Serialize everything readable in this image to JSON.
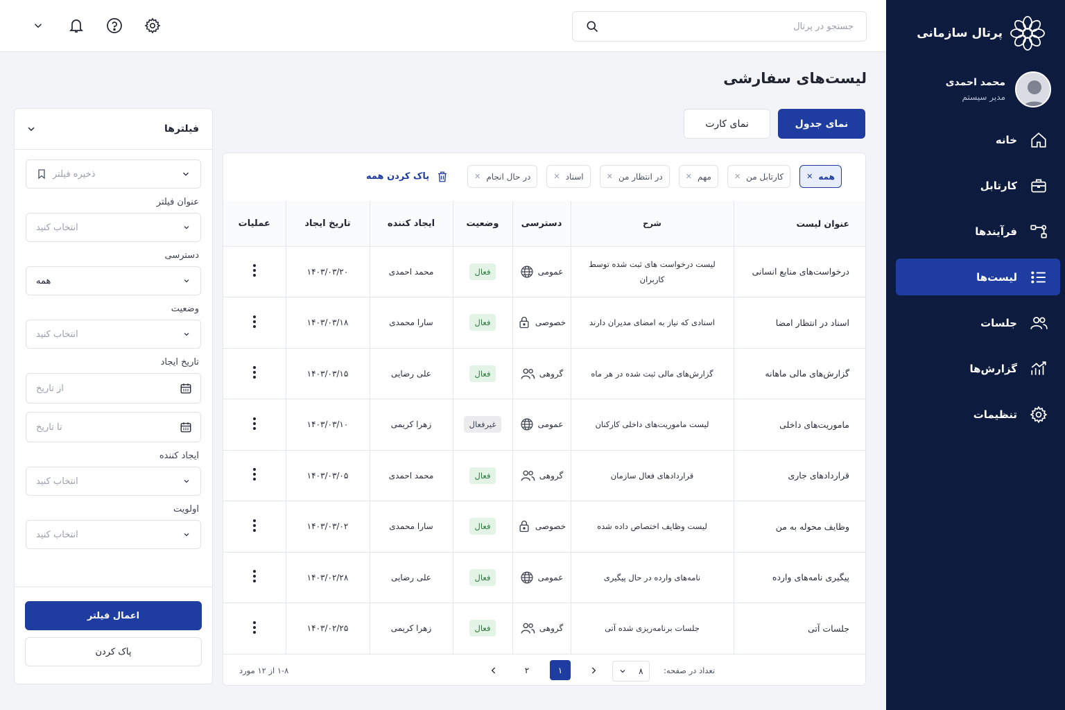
{
  "app": {
    "title": "پرتال سازمانی"
  },
  "user": {
    "name": "محمد احمدی",
    "role": "مدیر سیستم"
  },
  "sidebar": {
    "items": [
      {
        "label": "خانه",
        "icon": "home-icon",
        "active": false
      },
      {
        "label": "کارتابل",
        "icon": "briefcase-icon",
        "active": false
      },
      {
        "label": "فرآیندها",
        "icon": "workflow-icon",
        "active": false
      },
      {
        "label": "لیست‌ها",
        "icon": "list-icon",
        "active": true
      },
      {
        "label": "جلسات",
        "icon": "users-icon",
        "active": false
      },
      {
        "label": "گزارش‌ها",
        "icon": "chart-icon",
        "active": false
      },
      {
        "label": "تنظیمات",
        "icon": "gear-icon",
        "active": false
      }
    ]
  },
  "search": {
    "placeholder": "جستجو در پرتال",
    "value": ""
  },
  "page": {
    "title": "لیست‌های سفارشی"
  },
  "view_toggle": {
    "table": "نمای جدول",
    "card": "نمای کارت",
    "selected": "table"
  },
  "chips": [
    {
      "label": "همه",
      "active": true
    },
    {
      "label": "کارتابل من",
      "active": false
    },
    {
      "label": "مهم",
      "active": false
    },
    {
      "label": "در انتظار من",
      "active": false
    },
    {
      "label": "اسناد",
      "active": false
    },
    {
      "label": "در حال انجام",
      "active": false
    }
  ],
  "clear_all": "پاک کردن همه",
  "table": {
    "headers": {
      "title": "عنوان لیست",
      "desc": "شرح",
      "access": "دسترسی",
      "status": "وضعیت",
      "creator": "ایجاد کننده",
      "date": "تاریخ ایجاد",
      "ops": "عملیات"
    },
    "rows": [
      {
        "title": "درخواست‌های منابع انسانی",
        "desc": "لیست درخواست های ثبت شده توسط کاربران",
        "access": "عمومی",
        "access_icon": "globe-icon",
        "status": "فعال",
        "status_kind": "on",
        "creator": "محمد احمدی",
        "date": "۱۴۰۳/۰۳/۲۰"
      },
      {
        "title": "اسناد در انتظار امضا",
        "desc": "اسنادی که نیاز به امضای مدیران دارند",
        "access": "خصوصی",
        "access_icon": "lock-icon",
        "status": "فعال",
        "status_kind": "on",
        "creator": "سارا محمدی",
        "date": "۱۴۰۳/۰۳/۱۸"
      },
      {
        "title": "گزارش‌های مالی ماهانه",
        "desc": "گزارش‌های مالی ثبت شده در هر ماه",
        "access": "گروهی",
        "access_icon": "group-icon",
        "status": "فعال",
        "status_kind": "on",
        "creator": "علی رضایی",
        "date": "۱۴۰۳/۰۳/۱۵"
      },
      {
        "title": "ماموریت‌های داخلی",
        "desc": "لیست ماموریت‌های داخلی کارکنان",
        "access": "عمومی",
        "access_icon": "globe-icon",
        "status": "غیرفعال",
        "status_kind": "off",
        "creator": "زهرا کریمی",
        "date": "۱۴۰۳/۰۳/۱۰"
      },
      {
        "title": "قراردادهای جاری",
        "desc": "قراردادهای فعال سازمان",
        "access": "گروهی",
        "access_icon": "group-icon",
        "status": "فعال",
        "status_kind": "on",
        "creator": "محمد احمدی",
        "date": "۱۴۰۳/۰۳/۰۵"
      },
      {
        "title": "وظایف محوله به من",
        "desc": "لیست وظایف اختصاص داده شده",
        "access": "خصوصی",
        "access_icon": "lock-icon",
        "status": "فعال",
        "status_kind": "on",
        "creator": "سارا محمدی",
        "date": "۱۴۰۳/۰۳/۰۲"
      },
      {
        "title": "پیگیری نامه‌های وارده",
        "desc": "نامه‌های وارده در حال پیگیری",
        "access": "عمومی",
        "access_icon": "globe-icon",
        "status": "فعال",
        "status_kind": "on",
        "creator": "علی رضایی",
        "date": "۱۴۰۳/۰۲/۲۸"
      },
      {
        "title": "جلسات آتی",
        "desc": "جلسات برنامه‌ریزی شده آتی",
        "access": "گروهی",
        "access_icon": "group-icon",
        "status": "فعال",
        "status_kind": "on",
        "creator": "زهرا کریمی",
        "date": "۱۴۰۳/۰۲/۲۵"
      }
    ]
  },
  "pagination": {
    "per_page_label": "تعداد در صفحه:",
    "per_page": "۸",
    "pages": [
      "۱",
      "۲"
    ],
    "current": "۱",
    "range_text": "۱-۸ از ۱۲ مورد"
  },
  "filters": {
    "title": "فیلترها",
    "saved_placeholder": "ذخیره فیلتر",
    "fields": {
      "title_label": "عنوان فیلتر",
      "title_value": "انتخاب کنید",
      "access_label": "دسترسی",
      "access_value": "همه",
      "status_label": "وضعیت",
      "status_value": "انتخاب کنید",
      "date_label": "تاریخ ایجاد",
      "date_from": "از تاریخ",
      "date_to": "تا تاریخ",
      "creator_label": "ایجاد کننده",
      "creator_value": "انتخاب کنید",
      "priority_label": "اولویت",
      "priority_value": "انتخاب کنید"
    },
    "apply": "اعمال فیلتر",
    "clear": "پاک کردن"
  },
  "colors": {
    "sidebar": "#0d1b3e",
    "accent": "#1f3da0",
    "active_badge": "#e3f4e7",
    "inactive_badge": "#ececee"
  }
}
